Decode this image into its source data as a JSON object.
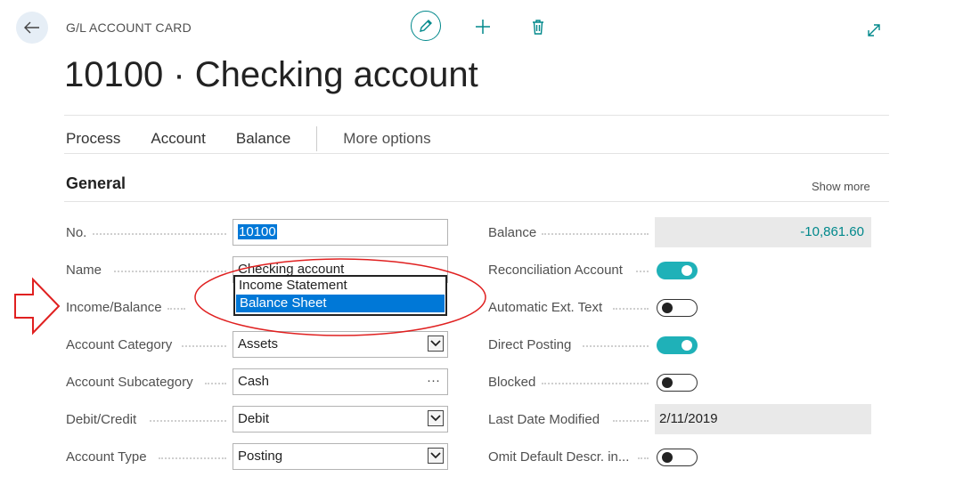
{
  "header": {
    "card_type": "G/L ACCOUNT CARD",
    "title": "10100 · Checking account",
    "icons": [
      "back-arrow-icon",
      "pencil-icon",
      "plus-icon",
      "trash-icon",
      "expand-icon"
    ]
  },
  "actions": {
    "process": "Process",
    "account": "Account",
    "balance": "Balance",
    "more": "More options"
  },
  "section": {
    "title": "General",
    "show_more": "Show more"
  },
  "left": {
    "no": {
      "label": "No.",
      "value": "10100"
    },
    "name": {
      "label": "Name",
      "value": "Checking account"
    },
    "income_balance": {
      "label": "Income/Balance",
      "options": [
        "Income Statement",
        "Balance Sheet"
      ],
      "selected": "Balance Sheet"
    },
    "account_category": {
      "label": "Account Category",
      "value": "Assets"
    },
    "account_subcategory": {
      "label": "Account Subcategory",
      "value": "Cash",
      "lookup": "···"
    },
    "debit_credit": {
      "label": "Debit/Credit",
      "value": "Debit"
    },
    "account_type": {
      "label": "Account Type",
      "value": "Posting"
    }
  },
  "right": {
    "balance": {
      "label": "Balance",
      "value": "-10,861.60"
    },
    "reconciliation": {
      "label": "Reconciliation Account",
      "on": true
    },
    "auto_ext_text": {
      "label": "Automatic Ext. Text",
      "on": false
    },
    "direct_posting": {
      "label": "Direct Posting",
      "on": true
    },
    "blocked": {
      "label": "Blocked",
      "on": false
    },
    "last_modified": {
      "label": "Last Date Modified",
      "value": "2/11/2019"
    },
    "omit_default": {
      "label": "Omit Default Descr. in...",
      "on": false
    }
  },
  "colors": {
    "accent": "#00888b",
    "toggle_on": "#1fb1b8",
    "selection": "#0078d7",
    "annotation": "#e02020"
  }
}
